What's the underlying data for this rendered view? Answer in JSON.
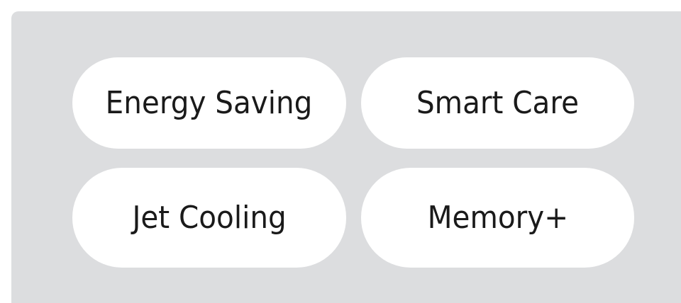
{
  "features": {
    "items": [
      {
        "label": "Energy Saving"
      },
      {
        "label": "Smart Care"
      },
      {
        "label": "Jet Cooling"
      },
      {
        "label": "Memory+"
      }
    ]
  },
  "colors": {
    "panel_background": "#dcdddf",
    "pill_background": "#ffffff",
    "text": "#1a1a1a"
  }
}
